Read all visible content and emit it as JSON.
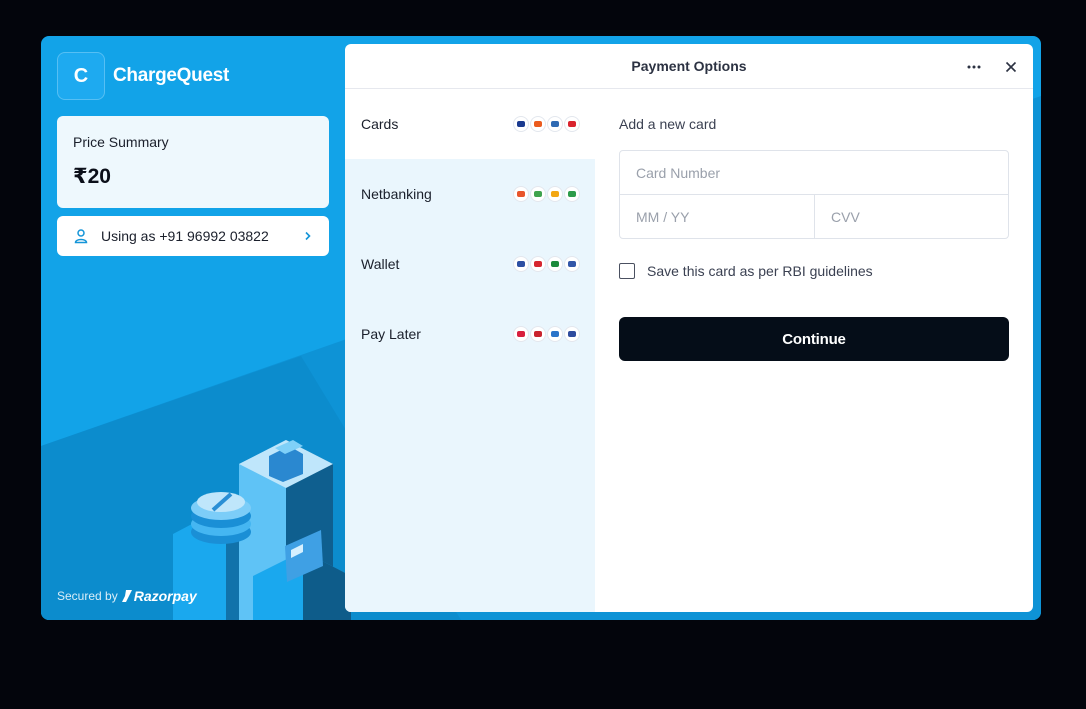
{
  "brand": {
    "logo_letter": "C",
    "name": "ChargeQuest"
  },
  "price_summary": {
    "label": "Price Summary",
    "amount": "₹20"
  },
  "user": {
    "text": "Using as +91 96992 03822",
    "icon": "user-icon"
  },
  "secured": {
    "label": "Secured by",
    "provider": "Razorpay"
  },
  "header": {
    "title": "Payment Options",
    "more_icon": "more-horizontal-icon",
    "close_icon": "close-icon"
  },
  "methods": [
    {
      "label": "Cards",
      "icons": [
        "visa-icon",
        "mastercard-icon",
        "rupay-icon",
        "maestro-icon"
      ],
      "icon_colors": [
        "#1a3a8f",
        "#eb5b1e",
        "#2f6ab3",
        "#d9232e"
      ]
    },
    {
      "label": "Netbanking",
      "icons": [
        "bank-icon",
        "bank-icon",
        "bank-icon",
        "bank-icon"
      ],
      "icon_colors": [
        "#e8552b",
        "#3fa34d",
        "#f3a712",
        "#2d9b4a"
      ]
    },
    {
      "label": "Wallet",
      "icons": [
        "wallet-icon",
        "wallet-icon",
        "wallet-icon",
        "wallet-icon"
      ],
      "icon_colors": [
        "#2c4fa3",
        "#d6262f",
        "#1b8a3b",
        "#3256a8"
      ]
    },
    {
      "label": "Pay Later",
      "icons": [
        "paylater-icon",
        "paylater-icon",
        "paylater-icon",
        "paylater-icon"
      ],
      "icon_colors": [
        "#d81f3d",
        "#c9232d",
        "#2a74c9",
        "#2f4c9e"
      ]
    }
  ],
  "form": {
    "title": "Add a new card",
    "card_number_placeholder": "Card Number",
    "expiry_placeholder": "MM / YY",
    "cvv_placeholder": "CVV",
    "save_label": "Save this card as per RBI guidelines",
    "continue_label": "Continue"
  },
  "colors": {
    "accent": "#12a3e8",
    "dark_button": "#050d18",
    "method_bg": "#eaf6fd"
  }
}
